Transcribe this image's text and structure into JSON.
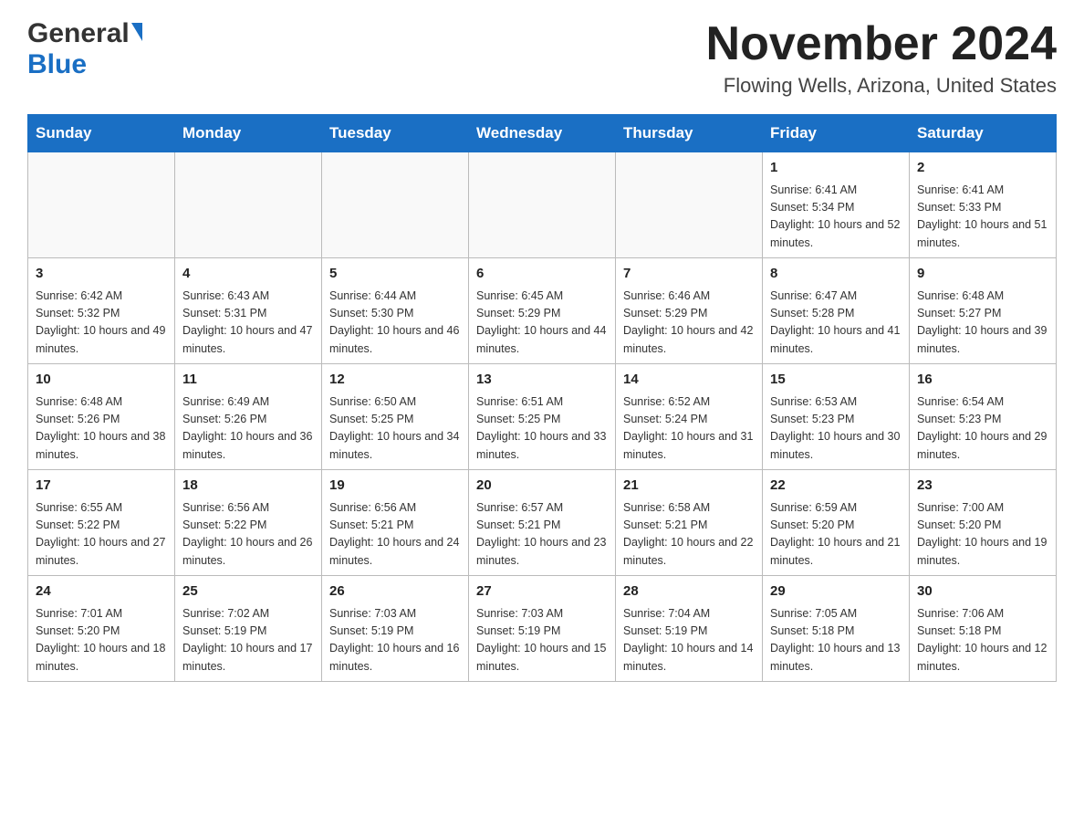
{
  "header": {
    "logo_general": "General",
    "logo_blue": "Blue",
    "month_title": "November 2024",
    "location": "Flowing Wells, Arizona, United States"
  },
  "weekdays": [
    "Sunday",
    "Monday",
    "Tuesday",
    "Wednesday",
    "Thursday",
    "Friday",
    "Saturday"
  ],
  "weeks": [
    [
      {
        "day": "",
        "info": ""
      },
      {
        "day": "",
        "info": ""
      },
      {
        "day": "",
        "info": ""
      },
      {
        "day": "",
        "info": ""
      },
      {
        "day": "",
        "info": ""
      },
      {
        "day": "1",
        "info": "Sunrise: 6:41 AM\nSunset: 5:34 PM\nDaylight: 10 hours and 52 minutes."
      },
      {
        "day": "2",
        "info": "Sunrise: 6:41 AM\nSunset: 5:33 PM\nDaylight: 10 hours and 51 minutes."
      }
    ],
    [
      {
        "day": "3",
        "info": "Sunrise: 6:42 AM\nSunset: 5:32 PM\nDaylight: 10 hours and 49 minutes."
      },
      {
        "day": "4",
        "info": "Sunrise: 6:43 AM\nSunset: 5:31 PM\nDaylight: 10 hours and 47 minutes."
      },
      {
        "day": "5",
        "info": "Sunrise: 6:44 AM\nSunset: 5:30 PM\nDaylight: 10 hours and 46 minutes."
      },
      {
        "day": "6",
        "info": "Sunrise: 6:45 AM\nSunset: 5:29 PM\nDaylight: 10 hours and 44 minutes."
      },
      {
        "day": "7",
        "info": "Sunrise: 6:46 AM\nSunset: 5:29 PM\nDaylight: 10 hours and 42 minutes."
      },
      {
        "day": "8",
        "info": "Sunrise: 6:47 AM\nSunset: 5:28 PM\nDaylight: 10 hours and 41 minutes."
      },
      {
        "day": "9",
        "info": "Sunrise: 6:48 AM\nSunset: 5:27 PM\nDaylight: 10 hours and 39 minutes."
      }
    ],
    [
      {
        "day": "10",
        "info": "Sunrise: 6:48 AM\nSunset: 5:26 PM\nDaylight: 10 hours and 38 minutes."
      },
      {
        "day": "11",
        "info": "Sunrise: 6:49 AM\nSunset: 5:26 PM\nDaylight: 10 hours and 36 minutes."
      },
      {
        "day": "12",
        "info": "Sunrise: 6:50 AM\nSunset: 5:25 PM\nDaylight: 10 hours and 34 minutes."
      },
      {
        "day": "13",
        "info": "Sunrise: 6:51 AM\nSunset: 5:25 PM\nDaylight: 10 hours and 33 minutes."
      },
      {
        "day": "14",
        "info": "Sunrise: 6:52 AM\nSunset: 5:24 PM\nDaylight: 10 hours and 31 minutes."
      },
      {
        "day": "15",
        "info": "Sunrise: 6:53 AM\nSunset: 5:23 PM\nDaylight: 10 hours and 30 minutes."
      },
      {
        "day": "16",
        "info": "Sunrise: 6:54 AM\nSunset: 5:23 PM\nDaylight: 10 hours and 29 minutes."
      }
    ],
    [
      {
        "day": "17",
        "info": "Sunrise: 6:55 AM\nSunset: 5:22 PM\nDaylight: 10 hours and 27 minutes."
      },
      {
        "day": "18",
        "info": "Sunrise: 6:56 AM\nSunset: 5:22 PM\nDaylight: 10 hours and 26 minutes."
      },
      {
        "day": "19",
        "info": "Sunrise: 6:56 AM\nSunset: 5:21 PM\nDaylight: 10 hours and 24 minutes."
      },
      {
        "day": "20",
        "info": "Sunrise: 6:57 AM\nSunset: 5:21 PM\nDaylight: 10 hours and 23 minutes."
      },
      {
        "day": "21",
        "info": "Sunrise: 6:58 AM\nSunset: 5:21 PM\nDaylight: 10 hours and 22 minutes."
      },
      {
        "day": "22",
        "info": "Sunrise: 6:59 AM\nSunset: 5:20 PM\nDaylight: 10 hours and 21 minutes."
      },
      {
        "day": "23",
        "info": "Sunrise: 7:00 AM\nSunset: 5:20 PM\nDaylight: 10 hours and 19 minutes."
      }
    ],
    [
      {
        "day": "24",
        "info": "Sunrise: 7:01 AM\nSunset: 5:20 PM\nDaylight: 10 hours and 18 minutes."
      },
      {
        "day": "25",
        "info": "Sunrise: 7:02 AM\nSunset: 5:19 PM\nDaylight: 10 hours and 17 minutes."
      },
      {
        "day": "26",
        "info": "Sunrise: 7:03 AM\nSunset: 5:19 PM\nDaylight: 10 hours and 16 minutes."
      },
      {
        "day": "27",
        "info": "Sunrise: 7:03 AM\nSunset: 5:19 PM\nDaylight: 10 hours and 15 minutes."
      },
      {
        "day": "28",
        "info": "Sunrise: 7:04 AM\nSunset: 5:19 PM\nDaylight: 10 hours and 14 minutes."
      },
      {
        "day": "29",
        "info": "Sunrise: 7:05 AM\nSunset: 5:18 PM\nDaylight: 10 hours and 13 minutes."
      },
      {
        "day": "30",
        "info": "Sunrise: 7:06 AM\nSunset: 5:18 PM\nDaylight: 10 hours and 12 minutes."
      }
    ]
  ]
}
